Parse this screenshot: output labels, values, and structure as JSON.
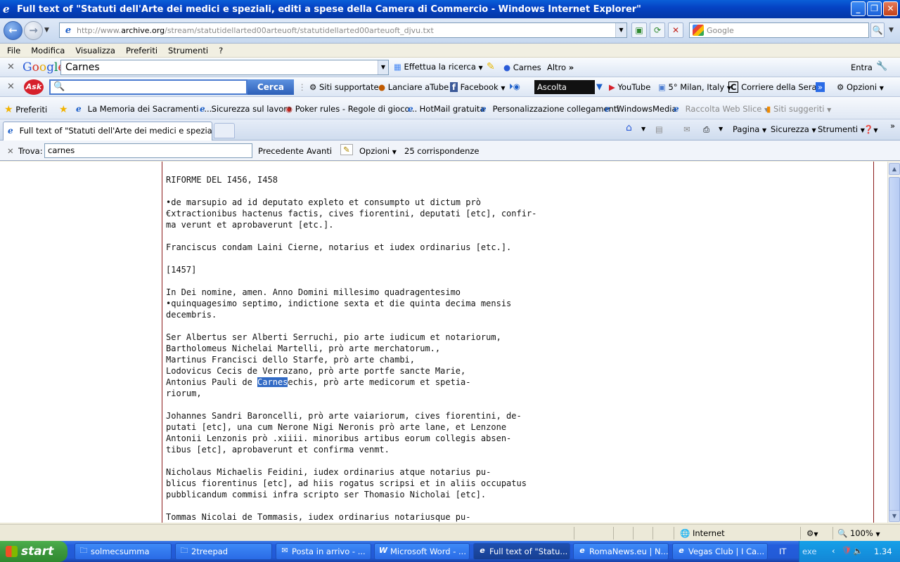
{
  "window": {
    "title": "Full text of \"Statuti dell'Arte dei medici e speziali, editi a spese della Camera di Commercio  - Windows Internet Explorer\""
  },
  "address": {
    "url_prefix": "http://www.",
    "url_domain": "archive.org",
    "url_path": "/stream/statutidellarted00arteuoft/statutidellarted00arteuoft_djvu.txt",
    "search_placeholder": "Google"
  },
  "menu": [
    "File",
    "Modifica",
    "Visualizza",
    "Preferiti",
    "Strumenti",
    "?"
  ],
  "google_toolbar": {
    "logo": "Google",
    "search_value": "Carnes",
    "search_button": "Effettua la ricerca",
    "highlight_term": "Carnes",
    "more": "Altro",
    "signin": "Entra"
  },
  "ask_toolbar": {
    "logo": "Ask",
    "search_button": "Cerca",
    "items": [
      "Siti supportate",
      "Lanciare aTube",
      "Facebook",
      "Ascolta musica",
      "YouTube",
      "5° Milan, Italy",
      "Corriere della Sera",
      "Opzioni"
    ]
  },
  "favorites": {
    "label": "Preferiti",
    "items": [
      "La Memoria dei Sacramenti -...",
      "Sicurezza sul lavoro",
      "Poker rules - Regole di gioco...",
      "HotMail gratuita",
      "Personalizzazione collegamenti",
      "WindowsMedia",
      "Raccolta Web Slice",
      "Siti suggeriti"
    ]
  },
  "tabs": {
    "active": "Full text of \"Statuti dell'Arte dei medici e speziali, editi ..."
  },
  "commandbar": [
    "Pagina",
    "Sicurezza",
    "Strumenti"
  ],
  "findbar": {
    "label": "Trova:",
    "value": "carnes",
    "prev": "Precedente",
    "next": "Avanti",
    "options": "Opzioni",
    "matches": "25 corrispondenze"
  },
  "document": {
    "lines_before": "RIFORME DEL I456, I458\n\n•de marsupio ad id deputato expleto et consumpto ut dictum prò\n€xtractionibus hactenus factis, cives fiorentini, deputati [etc], confir-\nma verunt et aprobaverunt [etc.].\n\nFranciscus condam Laini Cierne, notarius et iudex ordinarius [etc.].\n\n[1457]\n\nIn Dei nomine, amen. Anno Domini millesimo quadragentesimo\n•quinquagesimo septimo, indictione sexta et die quinta decima mensis\ndecembris.\n\nSer Albertus ser Alberti Serruchi, pio arte iudicum et notariorum,\nBartholomeus Nichelai Martelli, prò arte merchatorum.,\nMartinus Francisci dello Starfe, prò arte chambi,\nLodovicus Cecis de Verrazano, prò arte portfe sancte Marie,\n",
    "match_prefix": "Antonius Pauli de ",
    "match": "Carnes",
    "match_suffix": "echis, prò arte medicorum et spetia-",
    "lines_after": "riorum,\n\nJohannes Sandri Baroncelli, prò arte vaiariorum, cives fiorentini, de-\nputati [etc], una cum Nerone Nigi Neronis prò arte lane, et Lenzone\nAntonii Lenzonis prò .xiiii. minoribus artibus eorum collegis absen-\ntibus [etc], aprobaverunt et confirma venmt.\n\nNicholaus Michaelis Feidini, iudex ordinarius atque notarius pu-\nblicus fiorentinus [etc], ad hiis rogatus scripsi et in aliis occupatus\npubblicandum commisi infra scripto ser Thomasio Nicholai [etc].\n\nTommas Nicolai de Tommasis, iudex ordinarius notariusque pu-"
  },
  "status": {
    "zone": "Internet",
    "zoom": "100%"
  },
  "taskbar": {
    "start": "start",
    "tasks": [
      "solmecsumma",
      "2treepad",
      "Posta in arrivo - ...",
      "Microsoft Word - ...",
      "Full text of \"Statu...",
      "RomaNews.eu | N...",
      "Vegas Club | I Ca..."
    ],
    "lang": "IT",
    "tray_text": "exe",
    "clock": "1.34"
  }
}
